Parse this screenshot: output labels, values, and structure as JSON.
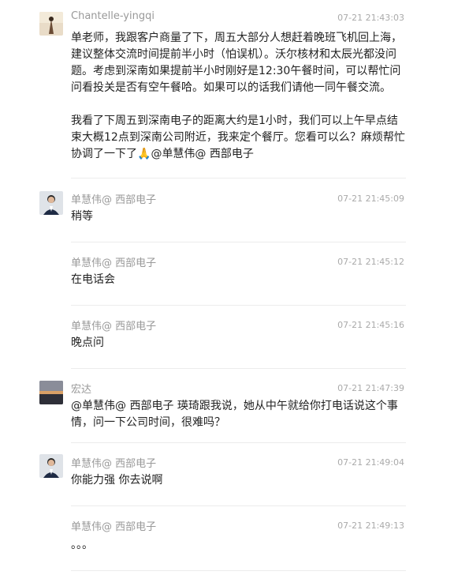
{
  "messages": [
    {
      "sender": "Chantelle-yingqi",
      "time": "07-21 21:43:03",
      "paragraphs": [
        "单老师，我跟客户商量了下，周五大部分人想赶着晚班飞机回上海，建议整体交流时间提前半小时（怕误机）。沃尔核材和太辰光都没问题。考虑到深南如果提前半小时刚好是12:30午餐时间，可以帮忙问问看投关是否有空午餐哈。如果可以的话我们请他一同午餐交流。",
        "我看了下周五到深南电子的距离大约是1小时，我们可以上午早点结束大概12点到深南公司附近，我来定个餐厅。您看可以么？麻烦帮忙协调了一下了",
        "@单慧伟@ 西部电子"
      ],
      "emoji": "🙏"
    },
    {
      "sender": "单慧伟@ 西部电子",
      "time": "07-21 21:45:09",
      "text": "稍等"
    },
    {
      "sender": "单慧伟@ 西部电子",
      "time": "07-21 21:45:12",
      "text": "在电话会"
    },
    {
      "sender": "单慧伟@ 西部电子",
      "time": "07-21 21:45:16",
      "text": "晚点问"
    },
    {
      "sender": "宏达",
      "time": "07-21 21:47:39",
      "text": "@单慧伟@ 西部电子 瑛琦跟我说，她从中午就给你打电话说这个事情，问一下公司时间，很难吗？"
    },
    {
      "sender": "单慧伟@ 西部电子",
      "time": "07-21 21:49:04",
      "text": "你能力强 你去说啊"
    },
    {
      "sender": "单慧伟@ 西部电子",
      "time": "07-21 21:49:13",
      "text": "。。。"
    }
  ],
  "colors": {
    "name": "#999999",
    "time": "#aaaaaa",
    "text": "#222222",
    "divider": "#ececec"
  }
}
